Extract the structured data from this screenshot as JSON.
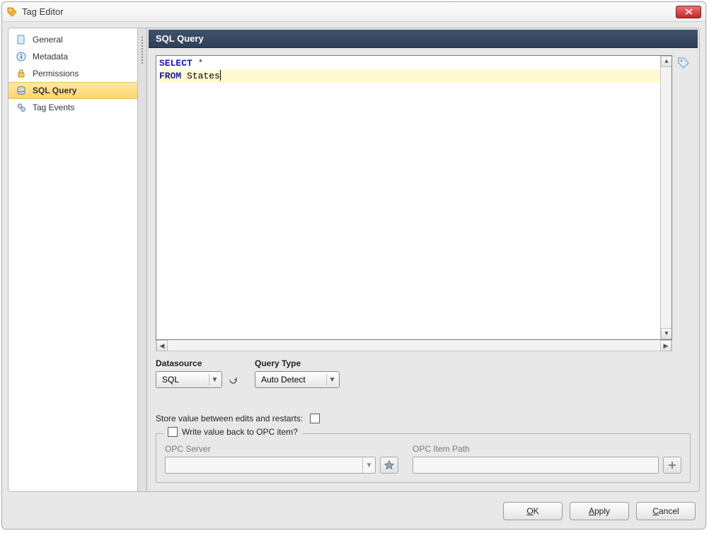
{
  "window": {
    "title": "Tag Editor"
  },
  "nav": {
    "items": [
      {
        "label": "General"
      },
      {
        "label": "Metadata"
      },
      {
        "label": "Permissions"
      },
      {
        "label": "SQL Query"
      },
      {
        "label": "Tag Events"
      }
    ],
    "selected_index": 3
  },
  "panel": {
    "title": "SQL Query"
  },
  "sql": {
    "kw_select": "SELECT",
    "star": " *",
    "kw_from": "FROM",
    "table": " States"
  },
  "datasource": {
    "label": "Datasource",
    "value": "SQL"
  },
  "querytype": {
    "label": "Query Type",
    "value": "Auto Detect"
  },
  "store_label": "Store value between edits and restarts:",
  "writeback": {
    "legend": "Write value back to OPC item?",
    "opc_server_label": "OPC Server",
    "opc_item_label": "OPC Item Path"
  },
  "buttons": {
    "ok_u": "O",
    "ok_rest": "K",
    "apply_u": "A",
    "apply_rest": "pply",
    "cancel_u": "C",
    "cancel_rest": "ancel"
  }
}
